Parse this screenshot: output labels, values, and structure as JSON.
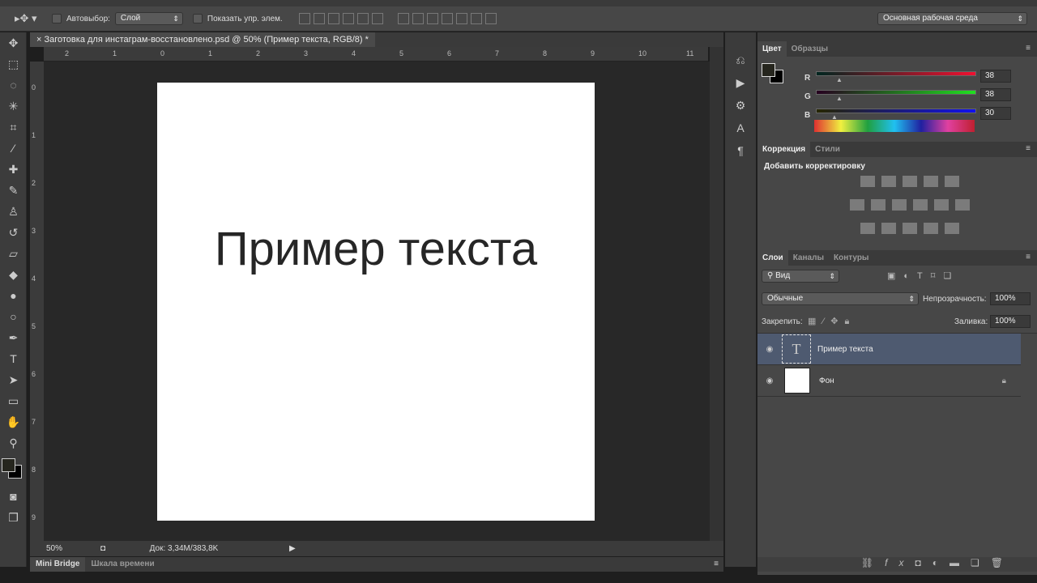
{
  "options": {
    "autoselect_label": "Автовыбор:",
    "autoselect_value": "Слой",
    "show_controls_label": "Показать упр. элем.",
    "workspace": "Основная рабочая среда"
  },
  "document": {
    "tab_title": "Заготовка для инстаграм-восстановлено.psd @ 50% (Пример текста, RGB/8) *",
    "canvas_text": "Пример текста"
  },
  "rulers": {
    "top": [
      "2",
      "1",
      "0",
      "1",
      "2",
      "3",
      "4",
      "5",
      "6",
      "7",
      "8",
      "9",
      "10",
      "11"
    ],
    "left": [
      "0",
      "1",
      "2",
      "3",
      "4",
      "5",
      "6",
      "7",
      "8",
      "9"
    ]
  },
  "status": {
    "zoom": "50%",
    "doc_info": "Док: 3,34M/383,8K"
  },
  "bottom_tabs": [
    "Mini Bridge",
    "Шкала времени"
  ],
  "color_panel": {
    "tabs": [
      "Цвет",
      "Образцы"
    ],
    "r_label": "R",
    "g_label": "G",
    "b_label": "B",
    "r": "38",
    "g": "38",
    "b": "30",
    "r_value": 38,
    "g_value": 38,
    "b_value": 30,
    "foreground": "#26261e",
    "background": "#000000"
  },
  "adjust_panel": {
    "tabs": [
      "Коррекция",
      "Стили"
    ],
    "heading": "Добавить корректировку"
  },
  "layers_panel": {
    "tabs": [
      "Слои",
      "Каналы",
      "Контуры"
    ],
    "filter": "Вид",
    "blend_mode": "Обычные",
    "opacity_label": "Непрозрачность:",
    "opacity": "100%",
    "lock_label": "Закрепить:",
    "fill_label": "Заливка:",
    "fill": "100%",
    "layers": [
      {
        "name": "Пример текста",
        "type": "text",
        "selected": true
      },
      {
        "name": "Фон",
        "type": "background",
        "locked": true
      }
    ]
  },
  "colors": {
    "selected_layer": "#4e5a70",
    "canvas_bg": "#282828",
    "panel": "#474747"
  }
}
